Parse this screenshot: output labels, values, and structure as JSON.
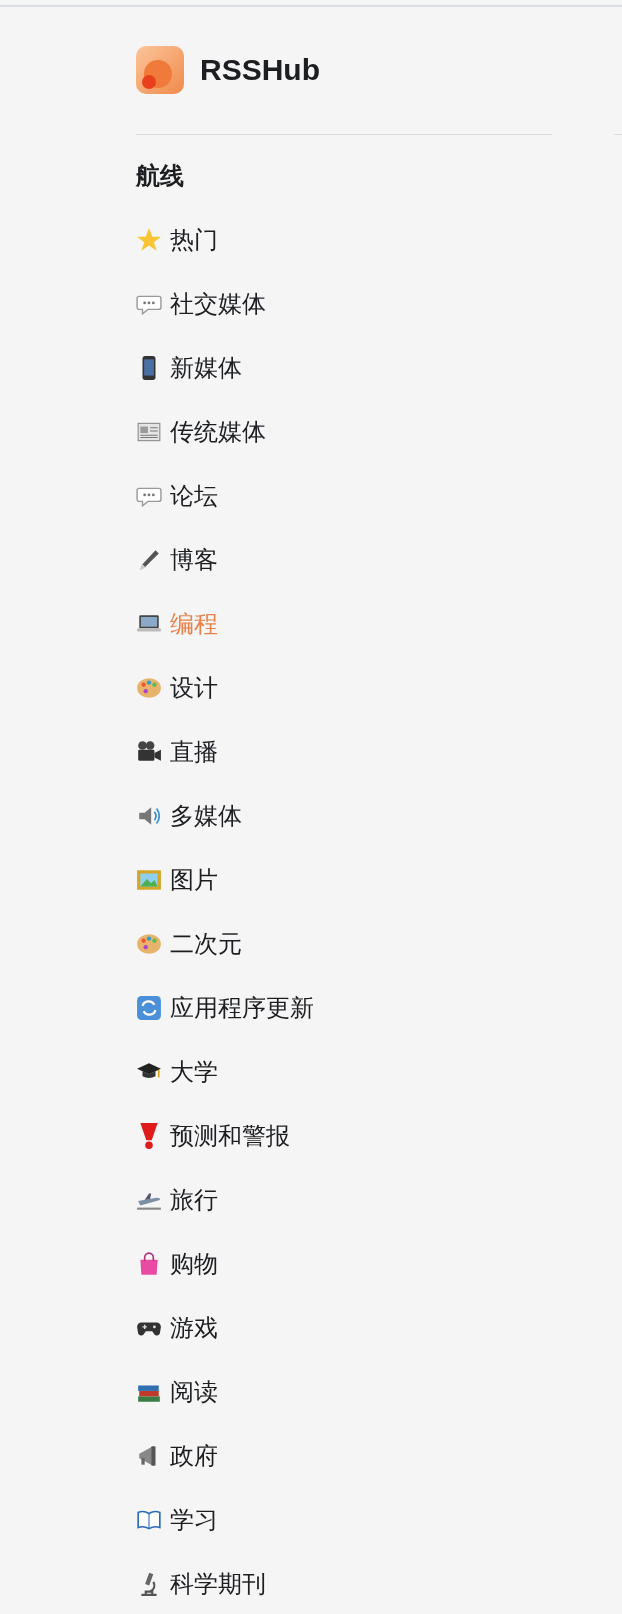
{
  "logo": {
    "title": "RSSHub"
  },
  "navigation": {
    "heading": "航线",
    "items": [
      {
        "label": "热门",
        "selected": false
      },
      {
        "label": "社交媒体",
        "selected": false
      },
      {
        "label": "新媒体",
        "selected": false
      },
      {
        "label": "传统媒体",
        "selected": false
      },
      {
        "label": "论坛",
        "selected": false
      },
      {
        "label": "博客",
        "selected": false
      },
      {
        "label": "编程",
        "selected": true
      },
      {
        "label": "设计",
        "selected": false
      },
      {
        "label": "直播",
        "selected": false
      },
      {
        "label": "多媒体",
        "selected": false
      },
      {
        "label": "图片",
        "selected": false
      },
      {
        "label": "二次元",
        "selected": false
      },
      {
        "label": "应用程序更新",
        "selected": false
      },
      {
        "label": "大学",
        "selected": false
      },
      {
        "label": "预测和警报",
        "selected": false
      },
      {
        "label": "旅行",
        "selected": false
      },
      {
        "label": "购物",
        "selected": false
      },
      {
        "label": "游戏",
        "selected": false
      },
      {
        "label": "阅读",
        "selected": false
      },
      {
        "label": "政府",
        "selected": false
      },
      {
        "label": "学习",
        "selected": false
      },
      {
        "label": "科学期刊",
        "selected": false
      }
    ]
  }
}
